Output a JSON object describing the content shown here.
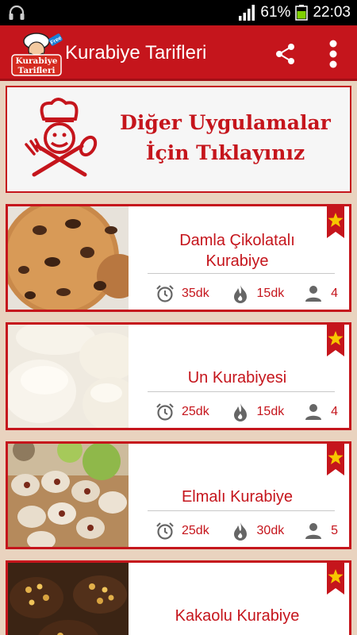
{
  "status_bar": {
    "battery_percent": "61%",
    "time": "22:03",
    "left_icon": "headphones-icon"
  },
  "app_bar": {
    "logo_text_line1": "Kurabiye",
    "logo_text_line2": "Tarifleri",
    "logo_badge": "Free",
    "title": "Kurabiye Tarifleri",
    "icons": [
      "share-icon",
      "more-vert-icon"
    ]
  },
  "banner": {
    "line1": "Diğer Uygulamalar",
    "line2": "İçin Tıklayınız"
  },
  "recipes": [
    {
      "title_line1": "Damla Çikolatalı",
      "title_line2": "Kurabiye",
      "prep_time": "35dk",
      "cook_time": "15dk",
      "servings": "4"
    },
    {
      "title_line1": "Un Kurabiyesi",
      "title_line2": "",
      "prep_time": "25dk",
      "cook_time": "15dk",
      "servings": "4"
    },
    {
      "title_line1": "Elmalı Kurabiye",
      "title_line2": "",
      "prep_time": "25dk",
      "cook_time": "30dk",
      "servings": "5"
    },
    {
      "title_line1": "Kakaolu Kurabiye",
      "title_line2": "",
      "prep_time": "",
      "cook_time": "",
      "servings": ""
    }
  ],
  "colors": {
    "primary": "#c5151c",
    "background": "#e9d3bf",
    "star": "#f7c600"
  }
}
